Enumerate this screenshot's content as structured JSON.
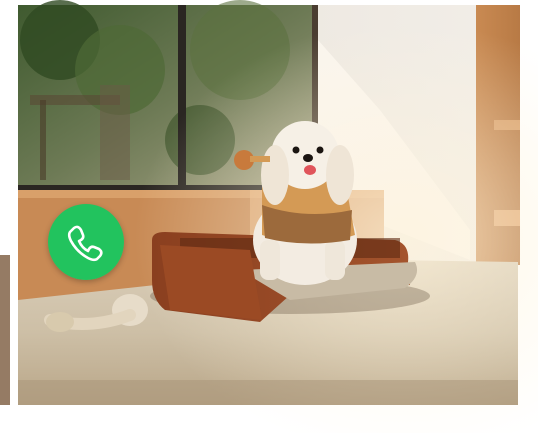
{
  "scene": {
    "subject": "dog-on-pet-bed",
    "icon": "phone-icon"
  },
  "call_button": {
    "icon": "phone-icon",
    "color": "#22c35e",
    "glyph_color": "#ffffff"
  }
}
